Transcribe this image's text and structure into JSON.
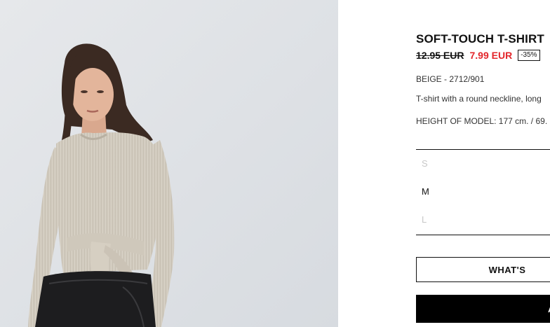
{
  "product": {
    "title": "SOFT-TOUCH T-SHIRT",
    "old_price": "12.95 EUR",
    "new_price": "7.99 EUR",
    "discount": "-35%",
    "color_ref": "BEIGE - 2712/901",
    "description": "T-shirt with a round neckline, long",
    "model_height": "HEIGHT OF MODEL: 177 cm. / 69."
  },
  "sizes": [
    {
      "label": "S",
      "available": false
    },
    {
      "label": "M",
      "available": true
    },
    {
      "label": "L",
      "available": false
    }
  ],
  "buttons": {
    "whats_label": "WHAT'S",
    "add_label": "A"
  },
  "colors": {
    "sale": "#e3262b",
    "photo_bg": "#dfe2e6"
  }
}
